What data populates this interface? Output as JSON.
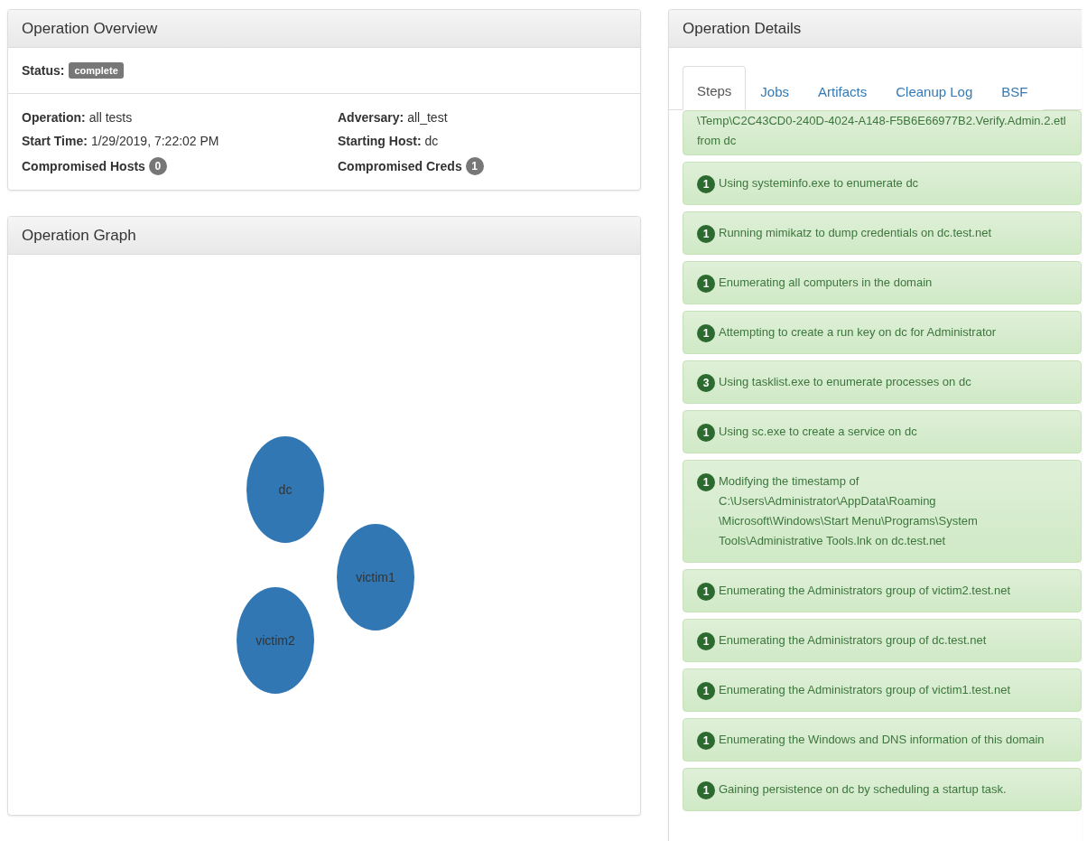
{
  "overview": {
    "title": "Operation Overview",
    "status": {
      "label": "Status:",
      "value": "complete"
    },
    "fields": [
      {
        "label": "Operation:",
        "value": "all tests",
        "kind": "text"
      },
      {
        "label": "Adversary:",
        "value": "all_test",
        "kind": "text"
      },
      {
        "label": "Start Time:",
        "value": "1/29/2019, 7:22:02 PM",
        "kind": "text"
      },
      {
        "label": "Starting Host:",
        "value": "dc",
        "kind": "text"
      },
      {
        "label": "Compromised Hosts",
        "value": "0",
        "kind": "count"
      },
      {
        "label": "Compromised Creds",
        "value": "1",
        "kind": "count"
      }
    ]
  },
  "graph": {
    "title": "Operation Graph",
    "nodes": [
      {
        "label": "dc"
      },
      {
        "label": "victim1"
      },
      {
        "label": "victim2"
      }
    ]
  },
  "details": {
    "title": "Operation Details",
    "tabs": [
      {
        "label": "Steps",
        "selected": true
      },
      {
        "label": "Jobs",
        "selected": false
      },
      {
        "label": "Artifacts",
        "selected": false
      },
      {
        "label": "Cleanup Log",
        "selected": false
      },
      {
        "label": "BSF",
        "selected": false
      }
    ],
    "steps": [
      {
        "text": "\\Temp\\C2C43CD0-240D-4024-A148-F5B6E66977B2.Verify.Admin.2.etl from dc"
      },
      {
        "count": "1",
        "text": "Using systeminfo.exe to enumerate dc"
      },
      {
        "count": "1",
        "text": "Running mimikatz to dump credentials on dc.test.net"
      },
      {
        "count": "1",
        "text": "Enumerating all computers in the domain"
      },
      {
        "count": "1",
        "text": "Attempting to create a run key on dc for Administrator"
      },
      {
        "count": "3",
        "text": "Using tasklist.exe to enumerate processes on dc"
      },
      {
        "count": "1",
        "text": "Using sc.exe to create a service on dc"
      },
      {
        "count": "1",
        "text": "Modifying the timestamp of C:\\Users\\Administrator\\AppData\\Roaming \\Microsoft\\Windows\\Start Menu\\Programs\\System Tools\\Administrative Tools.lnk on dc.test.net"
      },
      {
        "count": "1",
        "text": "Enumerating the Administrators group of victim2.test.net"
      },
      {
        "count": "1",
        "text": "Enumerating the Administrators group of dc.test.net"
      },
      {
        "count": "1",
        "text": "Enumerating the Administrators group of victim1.test.net"
      },
      {
        "count": "1",
        "text": "Enumerating the Windows and DNS information of this domain"
      },
      {
        "count": "1",
        "text": "Gaining persistence on dc by scheduling a startup task."
      }
    ]
  }
}
